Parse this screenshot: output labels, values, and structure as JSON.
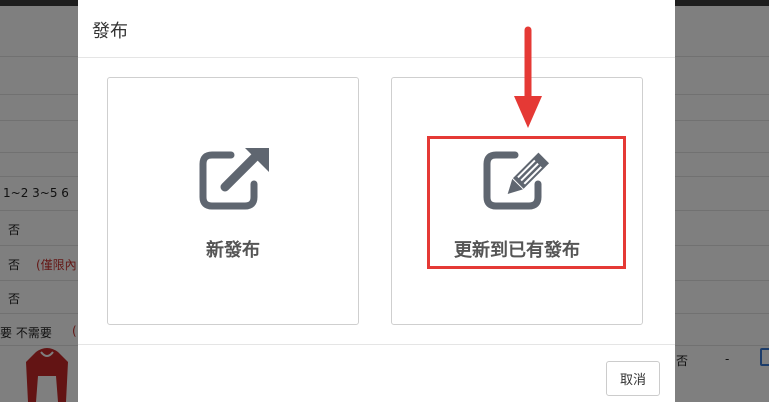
{
  "modal": {
    "title": "發布",
    "options": [
      {
        "label": "新發布",
        "icon": "external-link-icon"
      },
      {
        "label": "更新到已有發布",
        "icon": "edit-icon"
      }
    ],
    "cancel_label": "取消"
  },
  "background": {
    "filter_row": "1~2  3~5  6",
    "rows": [
      {
        "value": "否"
      },
      {
        "value": "否",
        "note": "(僅限內"
      },
      {
        "value": "否"
      }
    ],
    "need_row": "要  不需要",
    "need_row_paren": "(",
    "right_cell": "否",
    "right_dash": "-"
  },
  "colors": {
    "accent_red": "#e53935",
    "icon_gray": "#5f6670"
  }
}
